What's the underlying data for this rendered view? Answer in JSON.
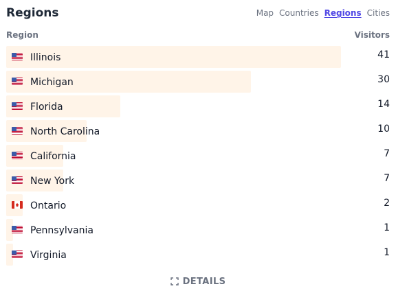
{
  "panel": {
    "title": "Regions",
    "tabs": [
      {
        "label": "Map",
        "active": false
      },
      {
        "label": "Countries",
        "active": false
      },
      {
        "label": "Regions",
        "active": true
      },
      {
        "label": "Cities",
        "active": false
      }
    ]
  },
  "table": {
    "headers": {
      "region": "Region",
      "visitors": "Visitors"
    },
    "rows": [
      {
        "flag_icon": "us-flag-icon",
        "region": "Illinois",
        "visitors": "41",
        "fill": 1.0
      },
      {
        "flag_icon": "us-flag-icon",
        "region": "Michigan",
        "visitors": "30",
        "fill": 0.73
      },
      {
        "flag_icon": "us-flag-icon",
        "region": "Florida",
        "visitors": "14",
        "fill": 0.34
      },
      {
        "flag_icon": "us-flag-icon",
        "region": "North Carolina",
        "visitors": "10",
        "fill": 0.24
      },
      {
        "flag_icon": "us-flag-icon",
        "region": "California",
        "visitors": "7",
        "fill": 0.17
      },
      {
        "flag_icon": "us-flag-icon",
        "region": "New York",
        "visitors": "7",
        "fill": 0.17
      },
      {
        "flag_icon": "canada-flag-icon",
        "region": "Ontario",
        "visitors": "2",
        "fill": 0.05
      },
      {
        "flag_icon": "us-flag-icon",
        "region": "Pennsylvania",
        "visitors": "1",
        "fill": 0.02
      },
      {
        "flag_icon": "us-flag-icon",
        "region": "Virginia",
        "visitors": "1",
        "fill": 0.02
      }
    ]
  },
  "footer": {
    "details_label": "DETAILS",
    "details_icon": "expand-icon"
  },
  "colors": {
    "accent": "#4f46e5",
    "bar_fill": "#fff4e8",
    "muted_text": "#6b7280",
    "primary_text": "#111827"
  }
}
